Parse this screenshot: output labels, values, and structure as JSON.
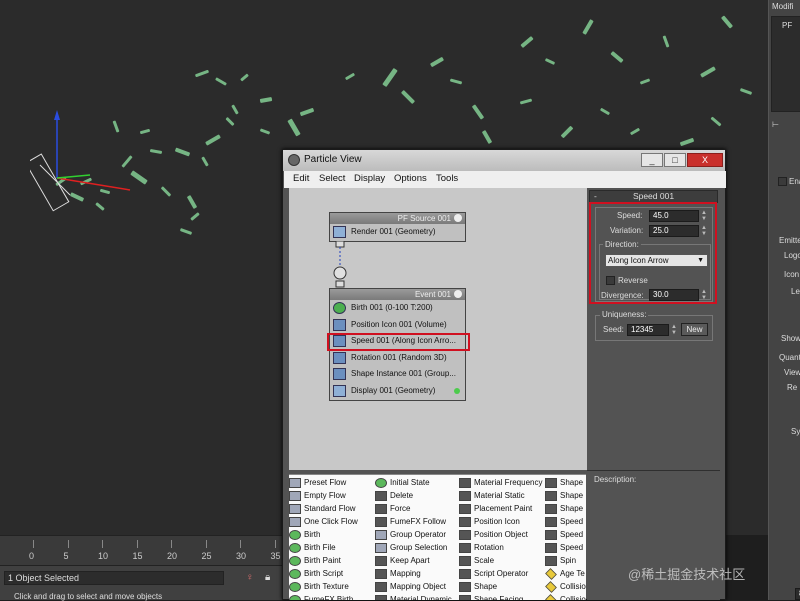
{
  "window": {
    "title": "Particle View",
    "minimize": "_",
    "maximize": "□",
    "close": "X"
  },
  "menus": [
    "Edit",
    "Select",
    "Display",
    "Options",
    "Tools"
  ],
  "nodes": {
    "source": {
      "title": "PF Source 001",
      "ops": [
        {
          "label": "Render 001 (Geometry)",
          "icon": "render-icon"
        }
      ]
    },
    "event": {
      "title": "Event 001",
      "ops": [
        {
          "label": "Birth 001 (0-100 T:200)",
          "icon": "birth-icon"
        },
        {
          "label": "Position Icon 001 (Volume)",
          "icon": "position-icon-icon"
        },
        {
          "label": "Speed 001 (Along Icon Arro...",
          "icon": "speed-icon"
        },
        {
          "label": "Rotation 001 (Random 3D)",
          "icon": "rotation-icon"
        },
        {
          "label": "Shape Instance 001 (Group...",
          "icon": "shape-instance-icon"
        },
        {
          "label": "Display 001 (Geometry)",
          "icon": "display-icon"
        }
      ]
    }
  },
  "speed_rollout": {
    "title": "Speed 001",
    "collapse": "-",
    "speed_label": "Speed:",
    "speed_value": "45.0",
    "variation_label": "Variation:",
    "variation_value": "25.0",
    "direction_label": "Direction:",
    "direction_value": "Along Icon Arrow",
    "reverse_label": "Reverse",
    "divergence_label": "Divergence:",
    "divergence_value": "30.0",
    "uniqueness_label": "Uniqueness:",
    "seed_label": "Seed:",
    "seed_value": "12345",
    "new_label": "New"
  },
  "description_label": "Description:",
  "depot": [
    [
      "Preset Flow",
      "Empty Flow",
      "Standard Flow",
      "One Click Flow",
      "Birth",
      "Birth File",
      "Birth Paint",
      "Birth Script",
      "Birth Texture",
      "FumeFX Birth"
    ],
    [
      "Initial State",
      "Delete",
      "Force",
      "FumeFX Follow",
      "Group Operator",
      "Group Selection",
      "Keep Apart",
      "Mapping",
      "Mapping Object",
      "Material Dynamic"
    ],
    [
      "Material Frequency",
      "Material Static",
      "Placement Paint",
      "Position Icon",
      "Position Object",
      "Rotation",
      "Scale",
      "Script Operator",
      "Shape",
      "Shape Facing"
    ],
    [
      "Shape",
      "Shape I",
      "Shape I",
      "Speed",
      "Speed I",
      "Speed I",
      "Spin",
      "Age Te",
      "Collisio",
      "Collisio",
      "Find Ta"
    ]
  ],
  "depot_icons": [
    [
      "b",
      "b",
      "b",
      "b",
      "g",
      "g",
      "g",
      "g",
      "g",
      "g"
    ],
    [
      "g",
      "d",
      "d",
      "d",
      "b",
      "b",
      "d",
      "d",
      "d",
      "d"
    ],
    [
      "d",
      "d",
      "d",
      "d",
      "d",
      "d",
      "d",
      "d",
      "d",
      "d"
    ],
    [
      "d",
      "d",
      "d",
      "d",
      "d",
      "d",
      "d",
      "y",
      "y",
      "y",
      "y"
    ]
  ],
  "timeline": {
    "ticks": [
      "0",
      "5",
      "10",
      "15",
      "20",
      "25",
      "30",
      "35"
    ]
  },
  "status": {
    "selected": "1 Object Selected",
    "prompt": "Click and drag to select and move objects"
  },
  "command_panel": {
    "modifier_label": "Modifi",
    "pf_label": "PF",
    "enable_label": "Ena",
    "emitter_label": "Emitte",
    "logo_label": "Logo",
    "icon_label": "Icon",
    "le_label": "Le",
    "show_label": "Show",
    "quant_label": "Quant",
    "view_label": "View",
    "re_label": "Re",
    "sy_label": "Sy",
    "frame_value": "86"
  },
  "watermark": "@稀土掘金技术社区"
}
